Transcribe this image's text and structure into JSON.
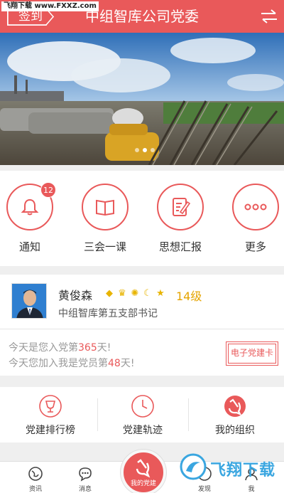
{
  "watermark": "飞翔下载 www.FXXZ.com",
  "header": {
    "checkin_label": "签到",
    "title": "中组智库公司党委"
  },
  "banner": {
    "slides": 3,
    "active_slide": 2
  },
  "quick_menu": [
    {
      "label": "通知",
      "icon": "bell-icon",
      "badge": "12"
    },
    {
      "label": "三会一课",
      "icon": "book-icon"
    },
    {
      "label": "思想汇报",
      "icon": "note-edit-icon"
    },
    {
      "label": "更多",
      "icon": "more-dots-icon"
    }
  ],
  "profile": {
    "name": "黄俊森",
    "medals": [
      "diamond-icon",
      "crown-icon",
      "sun-icon",
      "moon-icon",
      "star-icon"
    ],
    "level": "14级",
    "role": "中组智库第五支部书记",
    "days_party_prefix": "今天是您入党第",
    "days_party_value": "365",
    "days_party_suffix": "天!",
    "days_member_prefix": "今天您加入我是党员第",
    "days_member_value": "48",
    "days_member_suffix": "天!",
    "ecard_label": "电子党建卡"
  },
  "stats": [
    {
      "label": "党建排行榜",
      "icon": "trophy-icon"
    },
    {
      "label": "党建轨迹",
      "icon": "clock-icon"
    },
    {
      "label": "我的组织",
      "icon": "party-emblem-icon"
    }
  ],
  "nav": {
    "items": [
      {
        "label": "资讯",
        "icon": "globe-icon"
      },
      {
        "label": "消息",
        "icon": "chat-icon"
      },
      {
        "label": "发现",
        "icon": "discover-icon"
      },
      {
        "label": "我",
        "icon": "profile-icon"
      }
    ],
    "center_label": "我的党建"
  },
  "overlay_logo": "飞翔下载",
  "colors": {
    "primary": "#e9595a",
    "gold": "#e5a400",
    "muted": "#999999"
  }
}
